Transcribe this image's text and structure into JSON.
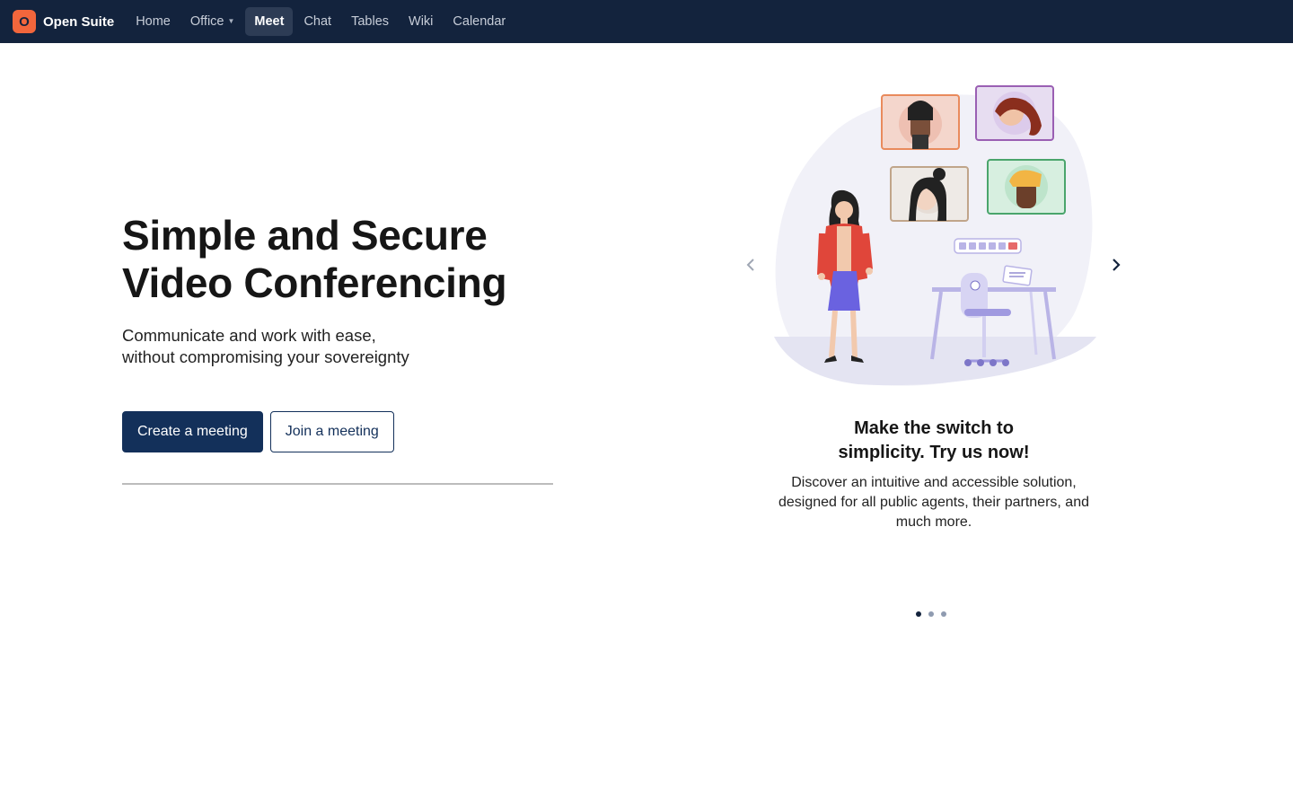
{
  "brand": {
    "logo_letter": "O",
    "name": "Open Suite",
    "logo_color": "#f2663c"
  },
  "nav": {
    "items": [
      {
        "label": "Home"
      },
      {
        "label": "Office"
      },
      {
        "label": "Meet"
      },
      {
        "label": "Chat"
      },
      {
        "label": "Tables"
      },
      {
        "label": "Wiki"
      },
      {
        "label": "Calendar"
      }
    ],
    "active": "Meet"
  },
  "hero": {
    "title_line1": "Simple and Secure",
    "title_line2": "Video Conferencing",
    "subtitle_line1": "Communicate and work with ease,",
    "subtitle_line2": "without compromising your sovereignty",
    "create_label": "Create a meeting",
    "join_label": "Join a meeting"
  },
  "carousel": {
    "slide_title_line1": "Make the switch to",
    "slide_title_line2": "simplicity. Try us now!",
    "slide_text": "Discover an intuitive and accessible solution, designed for all public agents, their partners, and much more.",
    "prev_icon": "chevron-left-icon",
    "next_icon": "chevron-right-icon",
    "slide_count": 3,
    "active_slide": 1
  },
  "colors": {
    "topbar": "#13233d",
    "primary": "#13305a",
    "accent": "#f2663c"
  }
}
